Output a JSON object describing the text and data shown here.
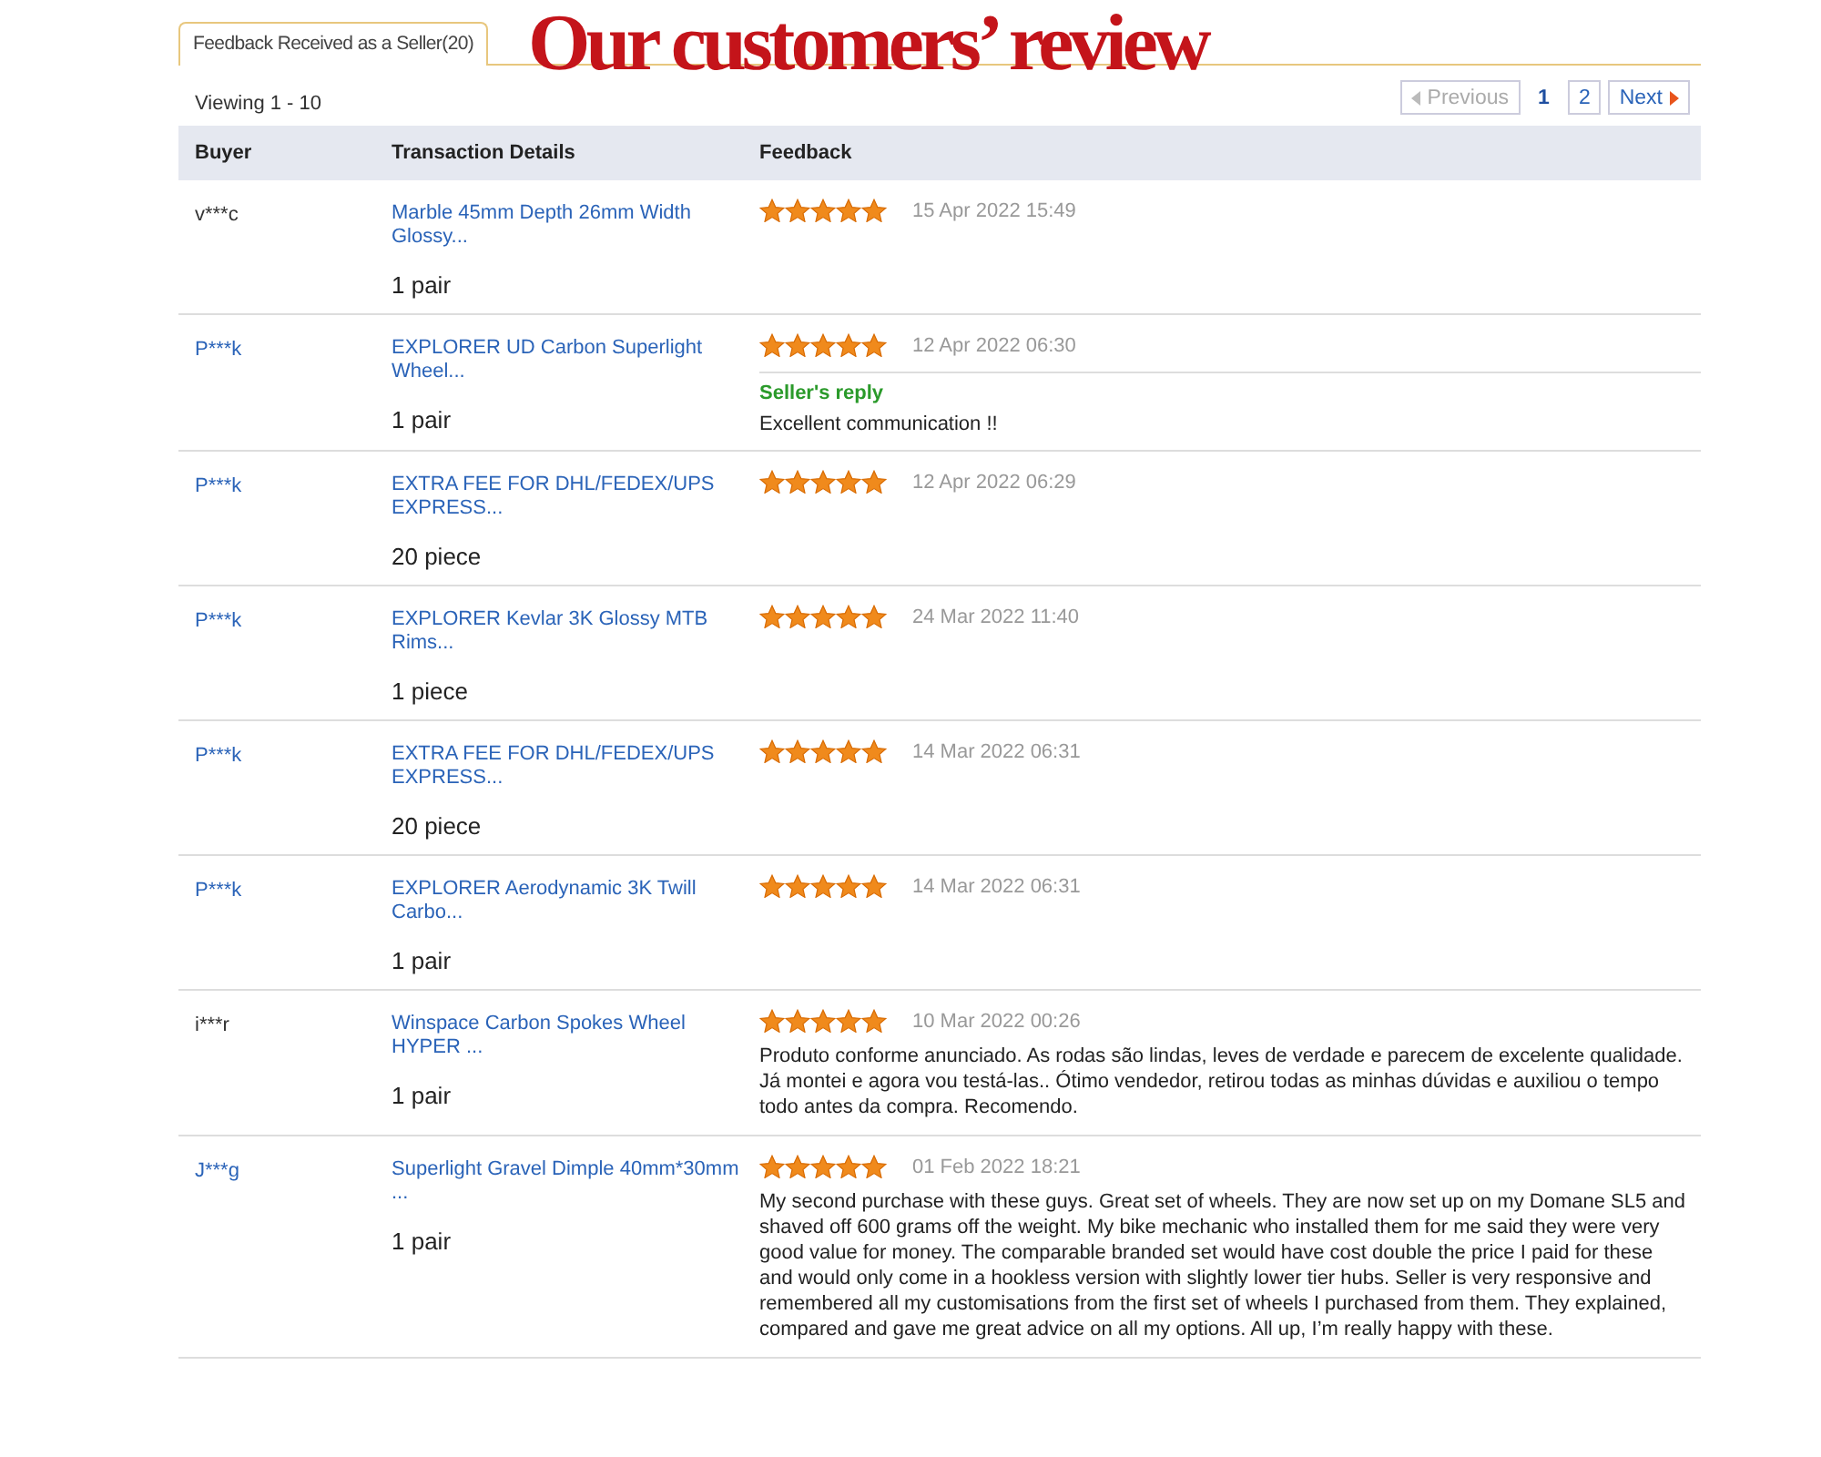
{
  "tab": {
    "label": "Feedback Received as a Seller(20)",
    "selected": true
  },
  "banner": "Our customers’ review",
  "viewing": "Viewing 1 - 10",
  "pagination": {
    "previous": {
      "label": "Previous",
      "disabled": true
    },
    "pages": [
      {
        "label": "1",
        "selected": true
      },
      {
        "label": "2",
        "selected": false
      }
    ],
    "next": {
      "label": "Next",
      "disabled": false
    }
  },
  "table": {
    "columns": [
      "Buyer",
      "Transaction Details",
      "Feedback"
    ],
    "rows": [
      {
        "buyer": "v***c",
        "buyer_linked": false,
        "product": "Marble 45mm Depth 26mm Width Glossy...",
        "quantity": "1 pair",
        "stars": 5,
        "date": "15 Apr 2022 15:49"
      },
      {
        "buyer": "P***k",
        "buyer_linked": true,
        "product": "EXPLORER UD Carbon Superlight Wheel...",
        "quantity": "1 pair",
        "stars": 5,
        "date": "12 Apr 2022 06:30",
        "seller_reply": {
          "label": "Seller's reply",
          "text": "Excellent communication !!"
        }
      },
      {
        "buyer": "P***k",
        "buyer_linked": true,
        "product": "EXTRA FEE FOR DHL/FEDEX/UPS EXPRESS...",
        "quantity": "20 piece",
        "stars": 5,
        "date": "12 Apr 2022 06:29"
      },
      {
        "buyer": "P***k",
        "buyer_linked": true,
        "product": "EXPLORER Kevlar 3K Glossy MTB Rims...",
        "quantity": "1 piece",
        "stars": 5,
        "date": "24 Mar 2022 11:40"
      },
      {
        "buyer": "P***k",
        "buyer_linked": true,
        "product": "EXTRA FEE FOR DHL/FEDEX/UPS EXPRESS...",
        "quantity": "20 piece",
        "stars": 5,
        "date": "14 Mar 2022 06:31"
      },
      {
        "buyer": "P***k",
        "buyer_linked": true,
        "product": "EXPLORER Aerodynamic 3K Twill Carbo...",
        "quantity": "1 pair",
        "stars": 5,
        "date": "14 Mar 2022 06:31"
      },
      {
        "buyer": "i***r",
        "buyer_linked": false,
        "product": "Winspace Carbon Spokes Wheel HYPER ...",
        "quantity": "1 pair",
        "stars": 5,
        "date": "10 Mar 2022 00:26",
        "comment": "Produto conforme anunciado. As rodas são lindas, leves de verdade e parecem de excelente qualidade. Já montei e agora vou testá-las.. Ótimo vendedor, retirou todas as minhas dúvidas e auxiliou o tempo todo antes da compra. Recomendo."
      },
      {
        "buyer": "J***g",
        "buyer_linked": true,
        "product": "Superlight Gravel Dimple 40mm*30mm ...",
        "quantity": "1 pair",
        "stars": 5,
        "date": "01 Feb 2022 18:21",
        "comment": "My second purchase with these guys. Great set of wheels. They are now set up on my Domane SL5 and shaved off 600 grams off the weight. My bike mechanic who installed them for me said they were very good value for money. The comparable branded set would have cost double the price I paid for these and would only come in a hookless version with slightly lower tier hubs. Seller is very responsive and remembered all my customisations from the first set of wheels I purchased from them. They explained, compared and gave me great advice on all my options. All up, I’m really happy with these."
      }
    ]
  }
}
